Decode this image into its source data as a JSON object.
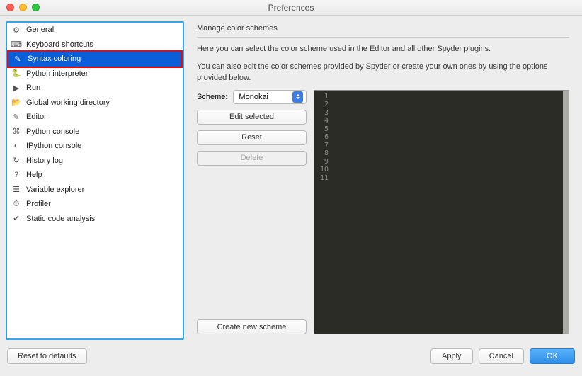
{
  "window": {
    "title": "Preferences"
  },
  "sidebar": {
    "items": [
      {
        "label": "General",
        "icon": "gear"
      },
      {
        "label": "Keyboard shortcuts",
        "icon": "keyboard"
      },
      {
        "label": "Syntax coloring",
        "icon": "brush",
        "selected": true,
        "highlighted": true
      },
      {
        "label": "Python interpreter",
        "icon": "python"
      },
      {
        "label": "Run",
        "icon": "play"
      },
      {
        "label": "Global working directory",
        "icon": "folder"
      },
      {
        "label": "Editor",
        "icon": "pencil"
      },
      {
        "label": "Python console",
        "icon": "console"
      },
      {
        "label": "IPython console",
        "icon": "ipy"
      },
      {
        "label": "History log",
        "icon": "history"
      },
      {
        "label": "Help",
        "icon": "help"
      },
      {
        "label": "Variable explorer",
        "icon": "vars"
      },
      {
        "label": "Profiler",
        "icon": "profiler"
      },
      {
        "label": "Static code analysis",
        "icon": "lint"
      }
    ]
  },
  "content": {
    "section_title": "Manage color schemes",
    "desc1": "Here you can select the color scheme used in the Editor and all other Spyder plugins.",
    "desc2": "You can also edit the color schemes provided by Spyder or create your own ones by using the options provided below.",
    "scheme_label": "Scheme:",
    "scheme_value": "Monokai",
    "edit_label": "Edit selected",
    "reset_label": "Reset",
    "delete_label": "Delete",
    "create_label": "Create new scheme",
    "preview_lines": [
      "1",
      "2",
      "3",
      "4",
      "5",
      "6",
      "7",
      "8",
      "9",
      "10",
      "11"
    ]
  },
  "footer": {
    "reset_defaults": "Reset to defaults",
    "apply": "Apply",
    "cancel": "Cancel",
    "ok": "OK"
  }
}
